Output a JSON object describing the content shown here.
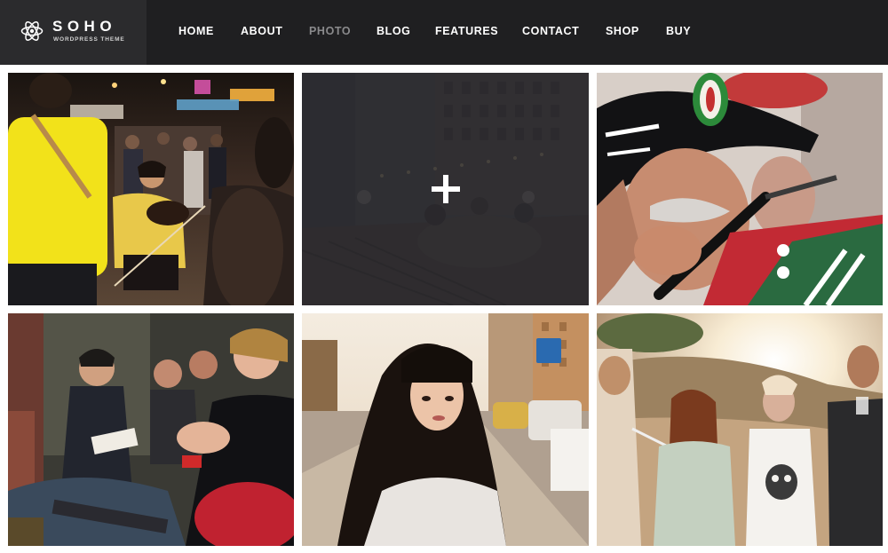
{
  "site": {
    "logo_title": "SOHO",
    "logo_subtitle": "WORDPRESS THEME",
    "logo_icon": "atom-icon"
  },
  "nav": {
    "active": "PHOTO",
    "items": [
      "HOME",
      "ABOUT",
      "PHOTO",
      "BLOG",
      "FEATURES",
      "CONTACT",
      "SHOP",
      "BUY"
    ]
  },
  "colors": {
    "header_bg": "#1f1f21",
    "logo_bg": "#2b2b2d",
    "nav_text": "#ffffff",
    "nav_active": "#8a8a8c",
    "overlay": "#28282c"
  },
  "gallery": {
    "hover_icon": "plus-icon",
    "photos": [
      {
        "subject": "street-market-violinist-photo"
      },
      {
        "subject": "rooftop-dinner-photo",
        "hovered": true
      },
      {
        "subject": "fife-player-soldier-photo"
      },
      {
        "subject": "conference-audience-photo"
      },
      {
        "subject": "woman-portrait-street-photo"
      },
      {
        "subject": "friends-sunset-photo"
      }
    ]
  }
}
